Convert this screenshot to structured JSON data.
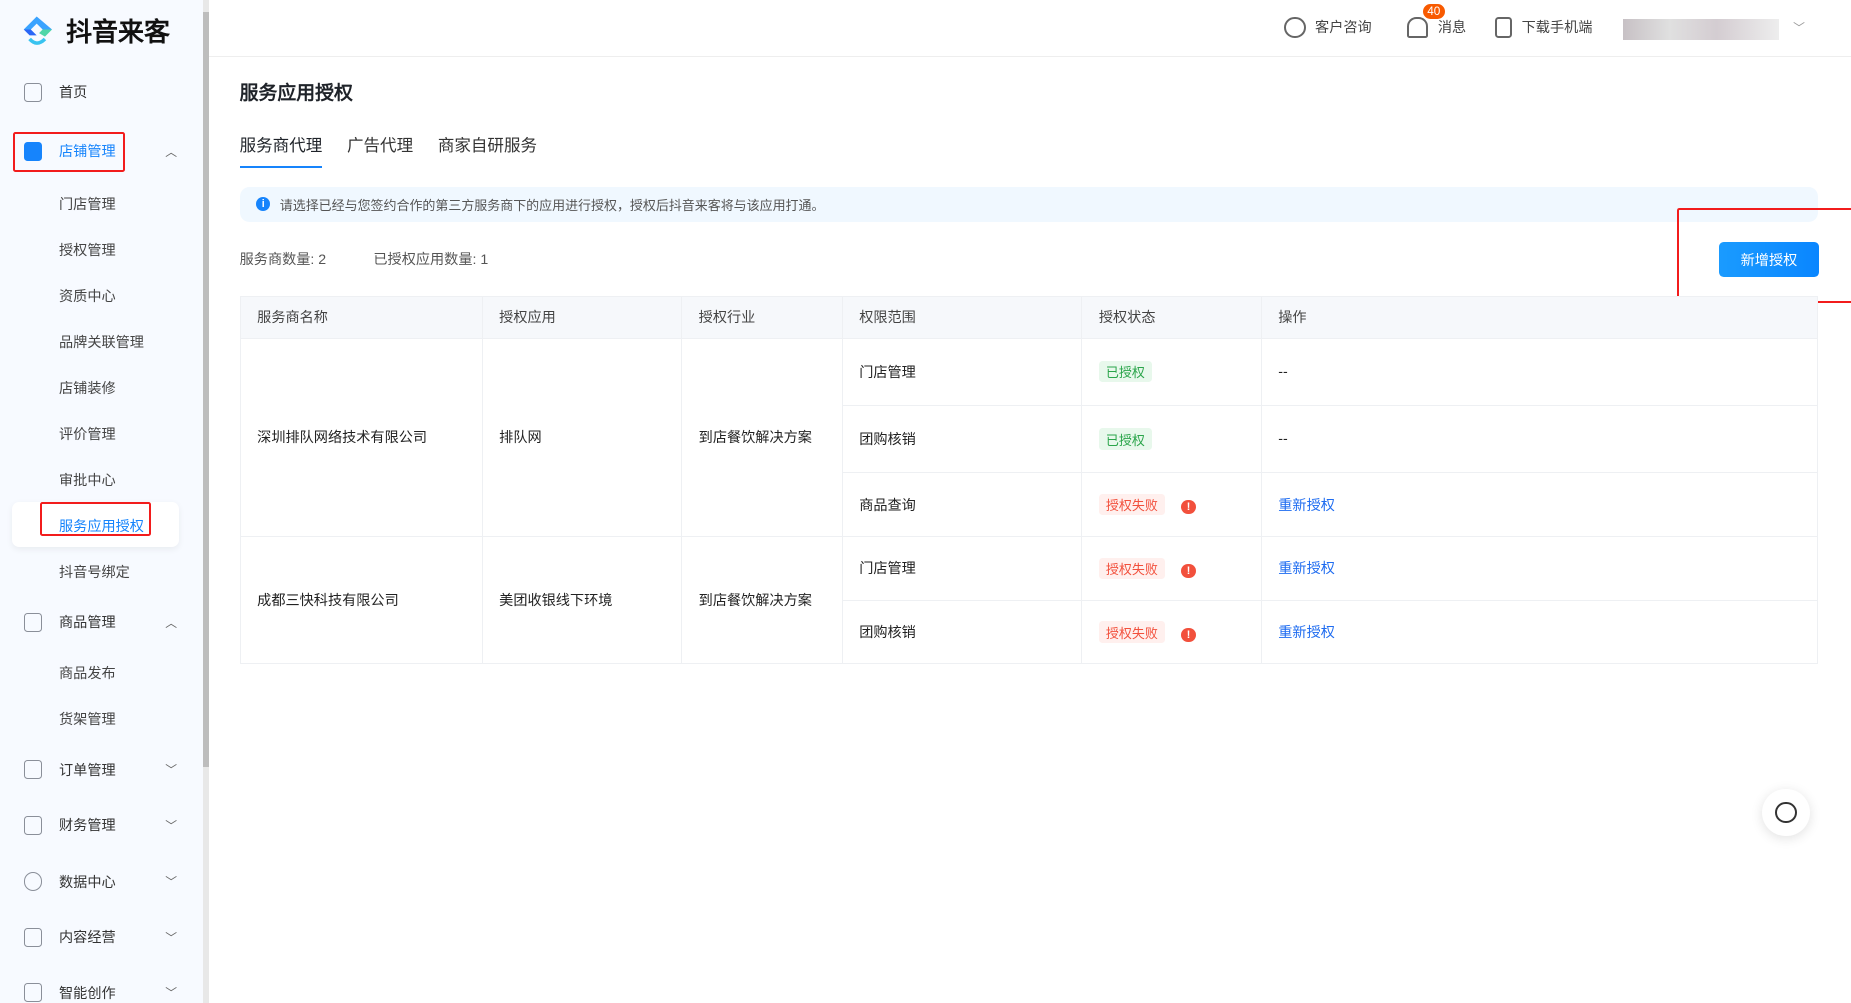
{
  "brand": "抖音来客",
  "sidebar": {
    "home": "首页",
    "store": {
      "label": "店铺管理",
      "items": [
        "门店管理",
        "授权管理",
        "资质中心",
        "品牌关联管理",
        "店铺装修",
        "评价管理",
        "审批中心",
        "服务应用授权",
        "抖音号绑定"
      ]
    },
    "goods": {
      "label": "商品管理",
      "items": [
        "商品发布",
        "货架管理"
      ]
    },
    "orders": "订单管理",
    "finance": "财务管理",
    "data": "数据中心",
    "content": "内容经营",
    "creation": "智能创作"
  },
  "topbar": {
    "support": "客户咨询",
    "messages": "消息",
    "message_count": "40",
    "download": "下载手机端"
  },
  "page": {
    "title": "服务应用授权",
    "tabs": [
      "服务商代理",
      "广告代理",
      "商家自研服务"
    ],
    "notice": "请选择已经与您签约合作的第三方服务商下的应用进行授权，授权后抖音来客将与该应用打通。",
    "provider_count": "服务商数量: 2",
    "authorized_count": "已授权应用数量: 1",
    "add_button": "新增授权"
  },
  "table": {
    "headers": [
      "服务商名称",
      "授权应用",
      "授权行业",
      "权限范围",
      "授权状态",
      "操作"
    ],
    "groups": [
      {
        "provider": "深圳排队网络技术有限公司",
        "app": "排队网",
        "industry": "到店餐饮解决方案",
        "rows": [
          {
            "scope": "门店管理",
            "status": "已授权",
            "action": "--"
          },
          {
            "scope": "团购核销",
            "status": "已授权",
            "action": "--"
          },
          {
            "scope": "商品查询",
            "status": "授权失败",
            "action": "重新授权"
          }
        ]
      },
      {
        "provider": "成都三快科技有限公司",
        "app": "美团收银线下环境",
        "industry": "到店餐饮解决方案",
        "rows": [
          {
            "scope": "门店管理",
            "status": "授权失败",
            "action": "重新授权"
          },
          {
            "scope": "团购核销",
            "status": "授权失败",
            "action": "重新授权"
          }
        ]
      }
    ]
  }
}
